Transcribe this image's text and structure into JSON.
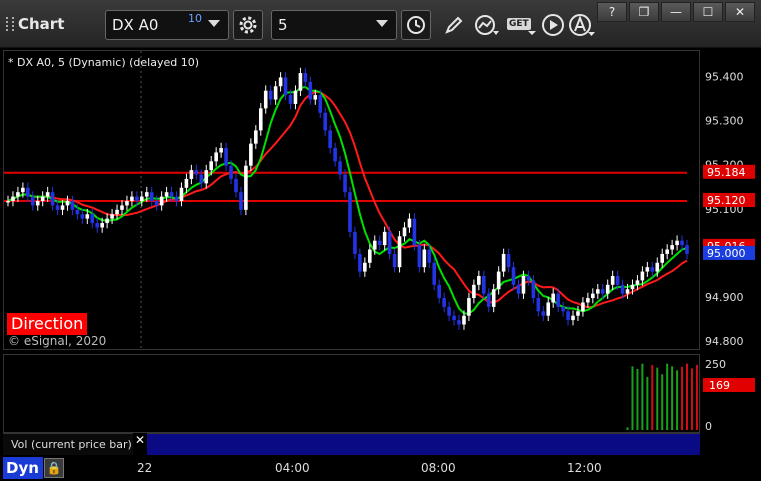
{
  "window": {
    "title": "Chart",
    "help_label": "?",
    "restore_label": "❐",
    "minimize_label": "—",
    "maximize_label": "☐",
    "close_label": "✕"
  },
  "toolbar": {
    "symbol_value": "DX A0",
    "symbol_badge": "10",
    "interval_value": "5",
    "get_label": "GET"
  },
  "chart": {
    "study_label": "* DX A0, 5 (Dynamic) (delayed 10)",
    "direction_label": "Direction",
    "copyright": "© eSignal, 2020",
    "price_ticks": [
      "95.400",
      "95.300",
      "95.200",
      "95.100",
      "95.000",
      "94.900",
      "94.800"
    ],
    "price_tags": [
      {
        "text": "95.184",
        "color": "#e00000"
      },
      {
        "text": "95.120",
        "color": "#e00000"
      },
      {
        "text": "95.016",
        "color": "#e00000"
      },
      {
        "text": "95.000",
        "color": "#1a3de0"
      }
    ],
    "colors": {
      "up": "#ffffff",
      "down": "#2234e6",
      "ma_fast": "#00e000",
      "ma_slow": "#ff1a1a",
      "level": "#e00000"
    }
  },
  "volume": {
    "label": "Vol (current price bar)",
    "close_label": "✕",
    "ticks": [
      "250",
      "0"
    ],
    "tag": "169",
    "tag_color": "#e00000"
  },
  "time_axis": {
    "mode_label": "Dyn",
    "lock_label": "🔒",
    "labels": [
      "22",
      "04:00",
      "08:00",
      "12:00"
    ]
  },
  "chart_data": {
    "type": "candlestick",
    "ylim": [
      94.78,
      95.46
    ],
    "close": [
      95.12,
      95.13,
      95.14,
      95.15,
      95.13,
      95.11,
      95.12,
      95.13,
      95.14,
      95.11,
      95.1,
      95.11,
      95.12,
      95.1,
      95.09,
      95.08,
      95.09,
      95.07,
      95.06,
      95.07,
      95.08,
      95.09,
      95.1,
      95.11,
      95.12,
      95.13,
      95.12,
      95.13,
      95.14,
      95.12,
      95.11,
      95.13,
      95.14,
      95.13,
      95.12,
      95.15,
      95.17,
      95.19,
      95.18,
      95.16,
      95.19,
      95.21,
      95.23,
      95.24,
      95.2,
      95.17,
      95.14,
      95.1,
      95.2,
      95.25,
      95.28,
      95.33,
      95.37,
      95.35,
      95.38,
      95.4,
      95.36,
      95.34,
      95.37,
      95.41,
      95.39,
      95.35,
      95.36,
      95.32,
      95.28,
      95.24,
      95.21,
      95.18,
      95.14,
      95.05,
      95.0,
      94.96,
      94.98,
      95.01,
      95.03,
      95.02,
      95.05,
      95.0,
      94.97,
      95.04,
      95.06,
      95.08,
      95.02,
      94.97,
      95.01,
      94.98,
      94.93,
      94.9,
      94.88,
      94.86,
      94.85,
      94.84,
      94.86,
      94.9,
      94.93,
      94.95,
      94.91,
      94.88,
      94.92,
      94.96,
      95.0,
      94.97,
      94.93,
      94.91,
      94.95,
      94.94,
      94.9,
      94.87,
      94.86,
      94.89,
      94.91,
      94.88,
      94.87,
      94.85,
      94.86,
      94.87,
      94.89,
      94.9,
      94.91,
      94.92,
      94.91,
      94.93,
      94.95,
      94.93,
      94.91,
      94.92,
      94.93,
      94.94,
      94.96,
      94.97,
      94.96,
      94.98,
      95.0,
      95.01,
      95.02,
      95.03,
      95.02,
      95.0
    ],
    "volume": [
      0,
      0,
      0,
      0,
      0,
      0,
      0,
      0,
      0,
      0,
      0,
      0,
      0,
      0,
      0,
      0,
      0,
      0,
      0,
      0,
      0,
      0,
      0,
      0,
      0,
      0,
      0,
      0,
      0,
      0,
      0,
      0,
      0,
      0,
      0,
      0,
      0,
      0,
      0,
      0,
      0,
      0,
      0,
      0,
      0,
      0,
      0,
      0,
      0,
      0,
      0,
      0,
      0,
      0,
      0,
      0,
      0,
      0,
      0,
      0,
      0,
      0,
      0,
      0,
      0,
      0,
      0,
      0,
      0,
      0,
      0,
      0,
      0,
      0,
      0,
      0,
      0,
      0,
      0,
      0,
      0,
      0,
      0,
      0,
      0,
      0,
      0,
      0,
      0,
      0,
      0,
      0,
      0,
      0,
      0,
      0,
      0,
      0,
      0,
      0,
      0,
      0,
      0,
      0,
      0,
      0,
      0,
      0,
      0,
      0,
      0,
      0,
      0,
      0,
      0,
      0,
      0,
      0,
      0,
      0,
      0,
      0,
      0,
      0,
      0,
      10,
      240,
      230,
      250,
      200,
      245,
      235,
      210,
      250,
      240,
      225,
      238,
      250,
      232,
      245,
      220,
      180,
      169
    ],
    "levels": [
      95.184,
      95.12
    ]
  }
}
